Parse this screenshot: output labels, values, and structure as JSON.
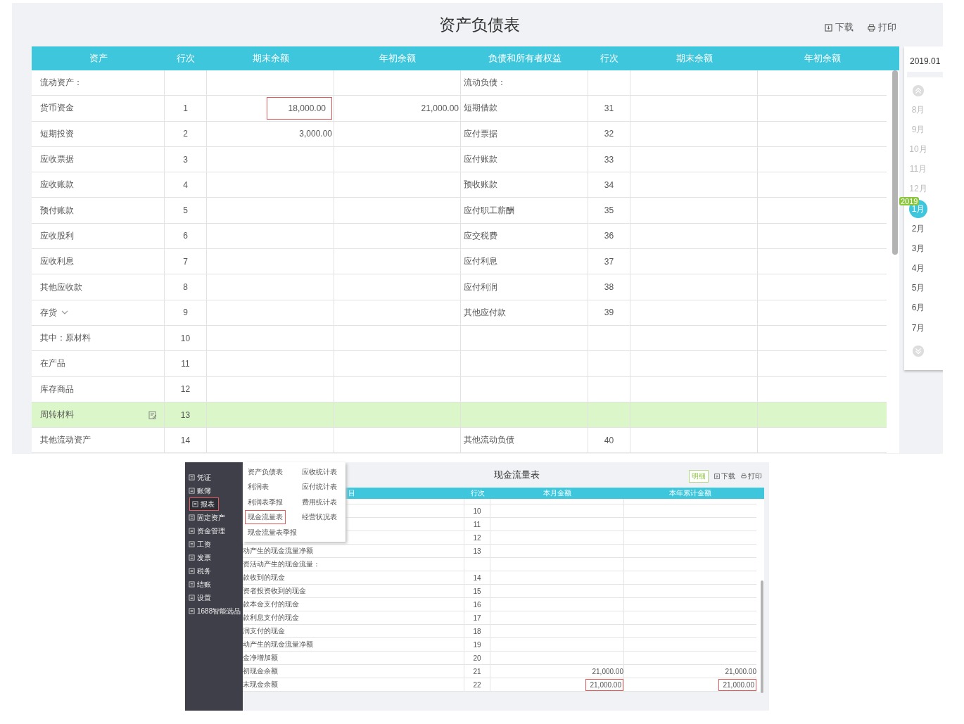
{
  "balance_sheet": {
    "title": "资产负债表",
    "actions": [
      {
        "kind": "download",
        "label": "下载"
      },
      {
        "kind": "print",
        "label": "打印"
      }
    ],
    "columns": [
      "资产",
      "行次",
      "期末余额",
      "年初余额",
      "负债和所有者权益",
      "行次",
      "期末余额",
      "年初余额"
    ],
    "rows": [
      {
        "selected": false,
        "kind": "plain",
        "cells": [
          "流动资产：",
          null,
          null,
          null,
          "流动负债：",
          null,
          null,
          null
        ],
        "marked": [
          false,
          false,
          false,
          false,
          false,
          false,
          false,
          false
        ]
      },
      {
        "selected": false,
        "kind": "plain",
        "cells": [
          "货币资金",
          "1",
          "18,000.00",
          "21,000.00",
          "短期借款",
          "31",
          null,
          null
        ],
        "marked": [
          false,
          false,
          true,
          false,
          false,
          false,
          false,
          false
        ]
      },
      {
        "selected": false,
        "kind": "plain",
        "cells": [
          "短期投资",
          "2",
          "3,000.00",
          null,
          "应付票据",
          "32",
          null,
          null
        ],
        "marked": [
          false,
          false,
          false,
          false,
          false,
          false,
          false,
          false
        ]
      },
      {
        "selected": false,
        "kind": "plain",
        "cells": [
          "应收票据",
          "3",
          null,
          null,
          "应付账款",
          "33",
          null,
          null
        ],
        "marked": [
          false,
          false,
          false,
          false,
          false,
          false,
          false,
          false
        ]
      },
      {
        "selected": false,
        "kind": "plain",
        "cells": [
          "应收账款",
          "4",
          null,
          null,
          "预收账款",
          "34",
          null,
          null
        ],
        "marked": [
          false,
          false,
          false,
          false,
          false,
          false,
          false,
          false
        ]
      },
      {
        "selected": false,
        "kind": "plain",
        "cells": [
          "预付账款",
          "5",
          null,
          null,
          "应付职工薪酬",
          "35",
          null,
          null
        ],
        "marked": [
          false,
          false,
          false,
          false,
          false,
          false,
          false,
          false
        ]
      },
      {
        "selected": false,
        "kind": "plain",
        "cells": [
          "应收股利",
          "6",
          null,
          null,
          "应交税费",
          "36",
          null,
          null
        ],
        "marked": [
          false,
          false,
          false,
          false,
          false,
          false,
          false,
          false
        ]
      },
      {
        "selected": false,
        "kind": "plain",
        "cells": [
          "应收利息",
          "7",
          null,
          null,
          "应付利息",
          "37",
          null,
          null
        ],
        "marked": [
          false,
          false,
          false,
          false,
          false,
          false,
          false,
          false
        ]
      },
      {
        "selected": false,
        "kind": "plain",
        "cells": [
          "其他应收款",
          "8",
          null,
          null,
          "应付利润",
          "38",
          null,
          null
        ],
        "marked": [
          false,
          false,
          false,
          false,
          false,
          false,
          false,
          false
        ]
      },
      {
        "selected": false,
        "kind": "expandable",
        "cells": [
          "存货",
          "9",
          null,
          null,
          "其他应付款",
          "39",
          null,
          null
        ],
        "marked": [
          false,
          false,
          false,
          false,
          false,
          false,
          false,
          false
        ]
      },
      {
        "selected": false,
        "kind": "plain",
        "cells": [
          "其中：原材料",
          "10",
          null,
          null,
          null,
          null,
          null,
          null
        ],
        "marked": [
          false,
          false,
          false,
          false,
          false,
          false,
          false,
          false
        ]
      },
      {
        "selected": false,
        "kind": "plain",
        "cells": [
          "在产品",
          "11",
          null,
          null,
          null,
          null,
          null,
          null
        ],
        "marked": [
          false,
          false,
          false,
          false,
          false,
          false,
          false,
          false
        ]
      },
      {
        "selected": false,
        "kind": "plain",
        "cells": [
          "库存商品",
          "12",
          null,
          null,
          null,
          null,
          null,
          null
        ],
        "marked": [
          false,
          false,
          false,
          false,
          false,
          false,
          false,
          false
        ]
      },
      {
        "selected": true,
        "kind": "editable",
        "cells": [
          "周转材料",
          "13",
          null,
          null,
          null,
          null,
          null,
          null
        ],
        "marked": [
          false,
          false,
          false,
          false,
          false,
          false,
          false,
          false
        ]
      },
      {
        "selected": false,
        "kind": "plain",
        "cells": [
          "其他流动资产",
          "14",
          null,
          null,
          "其他流动负债",
          "40",
          null,
          null
        ],
        "marked": [
          false,
          false,
          false,
          false,
          false,
          false,
          false,
          false
        ]
      }
    ],
    "period_field": "2019.01",
    "months": [
      {
        "label": "8月",
        "selected": false,
        "past": true
      },
      {
        "label": "9月",
        "selected": false,
        "past": true
      },
      {
        "label": "10月",
        "selected": false,
        "past": true
      },
      {
        "label": "11月",
        "selected": false,
        "past": true
      },
      {
        "label": "12月",
        "selected": false,
        "past": true
      },
      {
        "label": "1月",
        "selected": true,
        "past": false,
        "badge": "2019"
      },
      {
        "label": "2月",
        "selected": false,
        "past": false
      },
      {
        "label": "3月",
        "selected": false,
        "past": false
      },
      {
        "label": "4月",
        "selected": false,
        "past": false
      },
      {
        "label": "5月",
        "selected": false,
        "past": false
      },
      {
        "label": "6月",
        "selected": false,
        "past": false
      },
      {
        "label": "7月",
        "selected": false,
        "past": false
      }
    ]
  },
  "cash_flow": {
    "title": "现金流量表",
    "sidebar": [
      {
        "label": "凭证",
        "selected": false
      },
      {
        "label": "账簿",
        "selected": false
      },
      {
        "label": "报表",
        "selected": true
      },
      {
        "label": "固定资产",
        "selected": false
      },
      {
        "label": "资金管理",
        "selected": false
      },
      {
        "label": "工资",
        "selected": false
      },
      {
        "label": "发票",
        "selected": false
      },
      {
        "label": "税务",
        "selected": false
      },
      {
        "label": "结账",
        "selected": false
      },
      {
        "label": "设置",
        "selected": false
      },
      {
        "label": "1688智能选品",
        "selected": false
      }
    ],
    "menu": [
      {
        "label": "资产负债表",
        "selected": false
      },
      {
        "label": "应收统计表",
        "selected": false
      },
      {
        "label": "利润表",
        "selected": false
      },
      {
        "label": "应付统计表",
        "selected": false
      },
      {
        "label": "利润表季报",
        "selected": false
      },
      {
        "label": "费用统计表",
        "selected": false
      },
      {
        "label": "现金流量表",
        "selected": true
      },
      {
        "label": "经营状况表",
        "selected": false
      },
      {
        "label": "现金流量表季报",
        "selected": false
      }
    ],
    "actions": [
      {
        "kind": "detail",
        "label": "明细"
      },
      {
        "kind": "download",
        "label": "下载"
      },
      {
        "kind": "print",
        "label": "打印"
      }
    ],
    "columns": [
      "目",
      "行次",
      "本月金额",
      "本年累计金额"
    ],
    "rows": [
      {
        "cells": [
          null,
          "10",
          null,
          null
        ],
        "marked": [
          false,
          false,
          false,
          false
        ]
      },
      {
        "cells": [
          null,
          "11",
          null,
          null
        ],
        "marked": [
          false,
          false,
          false,
          false
        ]
      },
      {
        "cells": [
          null,
          "12",
          null,
          null
        ],
        "marked": [
          false,
          false,
          false,
          false
        ]
      },
      {
        "cells": [
          "动产生的现金流量净额",
          "13",
          null,
          null
        ],
        "marked": [
          false,
          false,
          false,
          false
        ]
      },
      {
        "cells": [
          "资活动产生的现金流量：",
          null,
          null,
          null
        ],
        "marked": [
          false,
          false,
          false,
          false
        ]
      },
      {
        "cells": [
          "款收到的现金",
          "14",
          null,
          null
        ],
        "marked": [
          false,
          false,
          false,
          false
        ]
      },
      {
        "cells": [
          "资者投资收到的现金",
          "15",
          null,
          null
        ],
        "marked": [
          false,
          false,
          false,
          false
        ]
      },
      {
        "cells": [
          "款本金支付的现金",
          "16",
          null,
          null
        ],
        "marked": [
          false,
          false,
          false,
          false
        ]
      },
      {
        "cells": [
          "款利息支付的现金",
          "17",
          null,
          null
        ],
        "marked": [
          false,
          false,
          false,
          false
        ]
      },
      {
        "cells": [
          "润支付的现金",
          "18",
          null,
          null
        ],
        "marked": [
          false,
          false,
          false,
          false
        ]
      },
      {
        "cells": [
          "动产生的现金流量净额",
          "19",
          null,
          null
        ],
        "marked": [
          false,
          false,
          false,
          false
        ]
      },
      {
        "cells": [
          "金净增加额",
          "20",
          null,
          null
        ],
        "marked": [
          false,
          false,
          false,
          false
        ]
      },
      {
        "cells": [
          "初现金余额",
          "21",
          "21,000.00",
          "21,000.00"
        ],
        "marked": [
          false,
          false,
          false,
          false
        ]
      },
      {
        "cells": [
          "末现金余额",
          "22",
          "21,000.00",
          "21,000.00"
        ],
        "marked": [
          false,
          false,
          true,
          true
        ]
      }
    ]
  }
}
